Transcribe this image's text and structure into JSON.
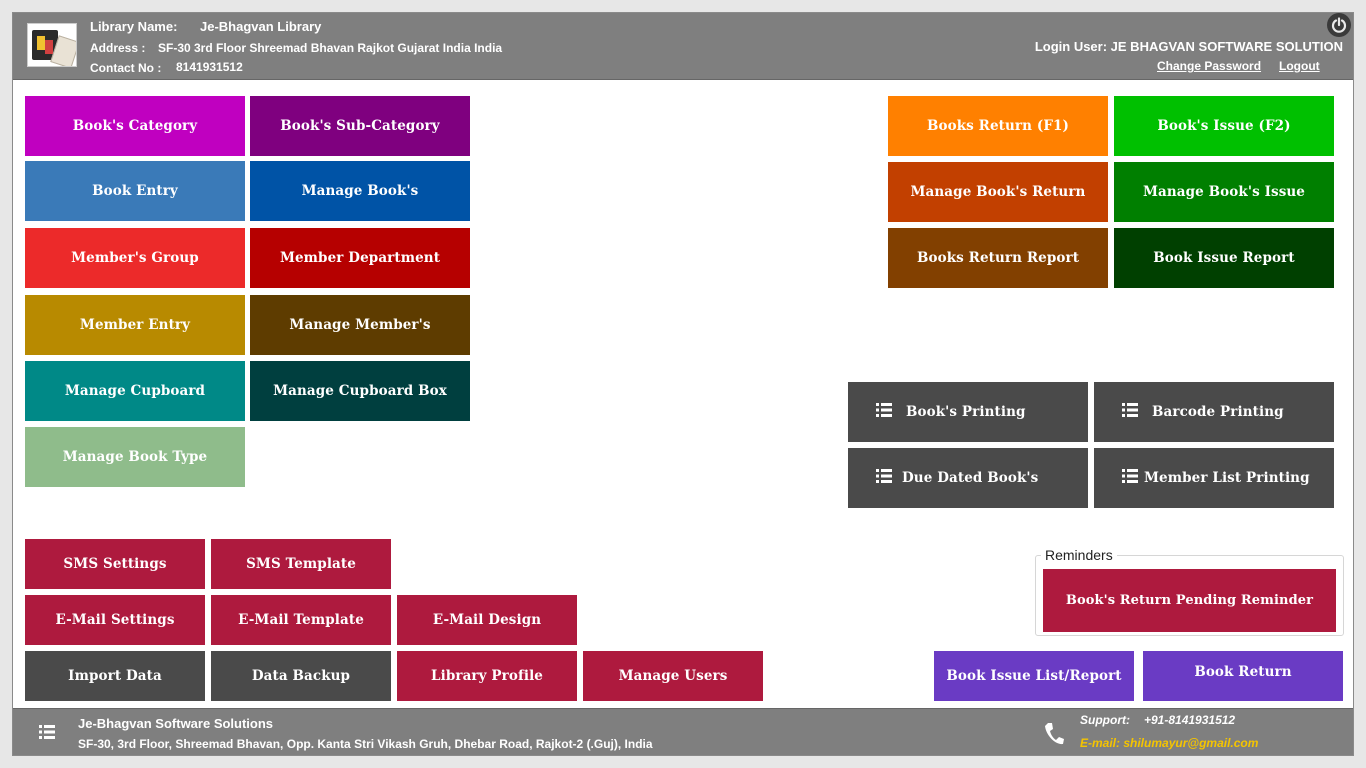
{
  "header": {
    "logo_icon": "library-terminal-logo",
    "library_name_label": "Library Name:",
    "library_name": "Je-Bhagvan Library",
    "address_label": "Address :",
    "address": "SF-30 3rd Floor Shreemad Bhavan Rajkot Gujarat India India",
    "contact_label": "Contact No :",
    "contact": "8141931512",
    "login_user": "Login User: JE BHAGVAN SOFTWARE SOLUTION",
    "change_password": "Change Password",
    "logout": "Logout",
    "power_icon": "power-icon"
  },
  "masters": {
    "books_category": "Book's Category",
    "books_subcategory": "Book's Sub-Category",
    "book_entry": "Book Entry",
    "manage_books": "Manage Book's",
    "members_group": "Member's Group",
    "member_department": "Member Department",
    "member_entry": "Member Entry",
    "manage_members": "Manage Member's",
    "manage_cupboard": "Manage Cupboard",
    "manage_cupboard_box": "Manage Cupboard Box",
    "manage_book_type": "Manage Book Type"
  },
  "transactions": {
    "books_return": "Books Return  (F1)",
    "books_issue": "Book's Issue (F2)",
    "manage_books_return": "Manage Book's Return",
    "manage_books_issue": "Manage Book's Issue",
    "books_return_report": "Books Return Report",
    "book_issue_report": "Book Issue Report"
  },
  "printing": {
    "books_printing": "Book's Printing",
    "barcode_printing": "Barcode Printing",
    "due_dated_books": "Due Dated Book's",
    "member_list_printing": "Member List Printing",
    "icon": "list-icon"
  },
  "settings": {
    "sms_settings": "SMS Settings",
    "sms_template": "SMS Template",
    "email_settings": "E-Mail Settings",
    "email_template": "E-Mail Template",
    "email_design": "E-Mail Design",
    "import_data": "Import Data",
    "data_backup": "Data Backup",
    "library_profile": "Library Profile",
    "manage_users": "Manage Users"
  },
  "reminders": {
    "title": "Reminders",
    "return_pending": "Book's Return Pending Reminder"
  },
  "quick": {
    "book_issue_list": "Book Issue List/Report",
    "book_return": "Book Return"
  },
  "footer": {
    "company": "Je-Bhagvan Software Solutions",
    "address": "SF-30, 3rd Floor, Shreemad Bhavan, Opp. Kanta Stri Vikash Gruh, Dhebar Road, Rajkot-2 (.Guj), India",
    "support_label": "Support:",
    "support_phone": "+91-8141931512",
    "email": "E-mail: shilumayur@gmail.com",
    "phone_icon": "phone-icon",
    "menu_icon": "menu-icon"
  },
  "colors": {
    "header_bg": "#7f7f7f",
    "magenta": "#c000c0",
    "purple": "#7f007f",
    "steel_blue": "#3a7ab8",
    "blue": "#0053a6",
    "red": "#ec2a2a",
    "dark_red": "#b60000",
    "gold": "#b88a00",
    "brown": "#5e3c00",
    "teal": "#008987",
    "dark_teal": "#003f3f",
    "sage": "#8fbc8b",
    "orange": "#ff8000",
    "green": "#00c000",
    "rust": "#c24000",
    "dark_green": "#007f00",
    "sienna": "#824000",
    "forest": "#004000",
    "charcoal": "#4a4a4a",
    "crimson": "#ae1a3e",
    "violet": "#6a3bc4"
  }
}
